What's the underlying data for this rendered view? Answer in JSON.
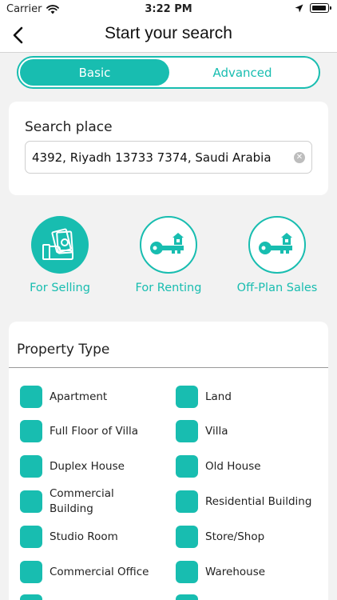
{
  "status_bar": {
    "carrier": "Carrier",
    "time": "3:22 PM"
  },
  "header": {
    "title": "Start your search"
  },
  "tabs": [
    {
      "label": "Basic",
      "active": true
    },
    {
      "label": "Advanced",
      "active": false
    }
  ],
  "search": {
    "label": "Search place",
    "value": "4392, Riyadh 13733 7374, Saudi Arabia"
  },
  "purpose_options": [
    {
      "label": "For Selling",
      "icon": "money-hand-icon",
      "selected": true
    },
    {
      "label": "For Renting",
      "icon": "key-house-icon",
      "selected": false
    },
    {
      "label": "Off-Plan Sales",
      "icon": "key-house-icon",
      "selected": false
    }
  ],
  "property_type": {
    "title": "Property Type",
    "items": [
      {
        "label": "Apartment"
      },
      {
        "label": "Land"
      },
      {
        "label": "Full Floor of Villa"
      },
      {
        "label": "Villa"
      },
      {
        "label": "Duplex House"
      },
      {
        "label": "Old House"
      },
      {
        "label": "Commercial Building"
      },
      {
        "label": "Residential Building"
      },
      {
        "label": "Studio Room"
      },
      {
        "label": "Store/Shop"
      },
      {
        "label": "Commercial Office"
      },
      {
        "label": "Warehouse"
      }
    ]
  },
  "colors": {
    "accent": "#18bdb0"
  }
}
